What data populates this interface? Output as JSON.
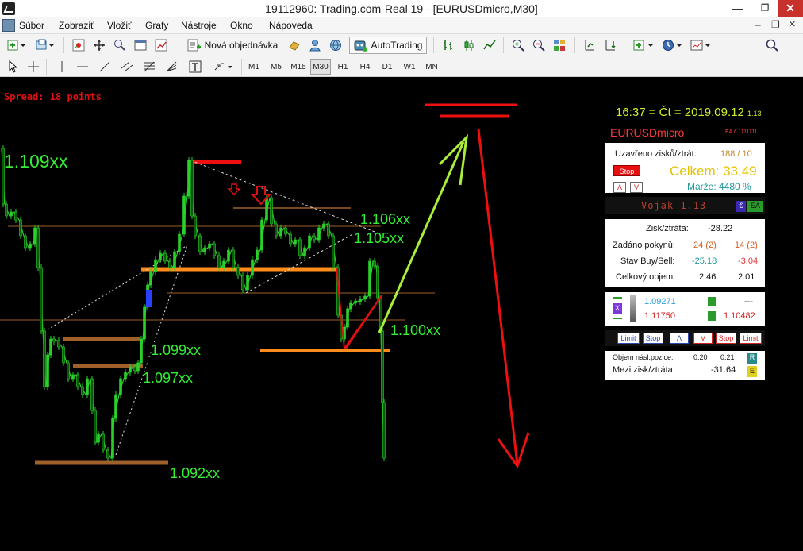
{
  "window": {
    "title": "19112960: Trading.com-Real 19 - [EURUSDmicro,M30]",
    "min": "—",
    "max": "❐",
    "close": "✕"
  },
  "menu": {
    "items": [
      "Súbor",
      "Zobraziť",
      "Vložiť",
      "Grafy",
      "Nástroje",
      "Okno",
      "Nápoveda"
    ],
    "mdi_min": "–",
    "mdi_max": "❐",
    "mdi_close": "×"
  },
  "toolbar": {
    "new_order": "Nová objednávka",
    "autotrading": "AutoTrading",
    "timeframes": [
      "M1",
      "M5",
      "M15",
      "M30",
      "H1",
      "H4",
      "D1",
      "W1",
      "MN"
    ],
    "active_timeframe": "M30"
  },
  "chart": {
    "spread": "Spread: 18 points",
    "labels": {
      "l1109": "1.109xx",
      "l1106": "1.106xx",
      "l1105": "1.105xx",
      "l1100": "1.100xx",
      "l1099": "1.099xx",
      "l1097": "1.097xx",
      "l1092": "1.092xx"
    }
  },
  "panel": {
    "time": "16:37 = Čt = 2019.09.12",
    "version_small": "1.13",
    "symbol": "EURUSDmicro",
    "ea_number": "EA č.1111111",
    "closed_label": "Uzavřeno zisků/ztrát:",
    "closed_value": "188 / 10",
    "stop_btn": "Stop",
    "celkem": "Celkem: 33.49",
    "btn_up": "Λ",
    "btn_down": "V",
    "marze": "Marže:  4480 %",
    "vojak": "Vojak 1.13",
    "euro_btn": "€",
    "ea_btn": "EA",
    "profit_label": "Zisk/ztráta:",
    "profit_value": "-28.22",
    "orders_label": "Zadáno pokynů:",
    "orders_buy": "24 (2)",
    "orders_sell": "14 (2)",
    "state_label": "Stav Buy/Sell:",
    "state_buy": "-25.18",
    "state_sell": "-3.04",
    "volume_label": "Celkový objem:",
    "volume_buy": "2.46",
    "volume_sell": "2.01",
    "x_btn": "X",
    "price_buy": "1.09271",
    "price_sell": "1.11750",
    "right_top": "---",
    "right_bottom": "1.10482",
    "buttons": [
      "Limit",
      "Stop",
      "Λ",
      "V",
      "Stop",
      "Limit"
    ],
    "next_volume_label": "Objem násl.pozice:",
    "next_volume_buy": "0.20",
    "next_volume_sell": "0.21",
    "r_btn": "R",
    "inter_label": "Mezi zisk/ztráta:",
    "inter_value": "-31.64",
    "e_btn": "E"
  },
  "colors": {
    "accent_red": "#e01010",
    "label_green": "#33ee33",
    "time_yellow": "#cfee30",
    "total_gold": "#e7c200",
    "buy_blue": "#2aa0e0",
    "sell_red": "#d02020"
  }
}
